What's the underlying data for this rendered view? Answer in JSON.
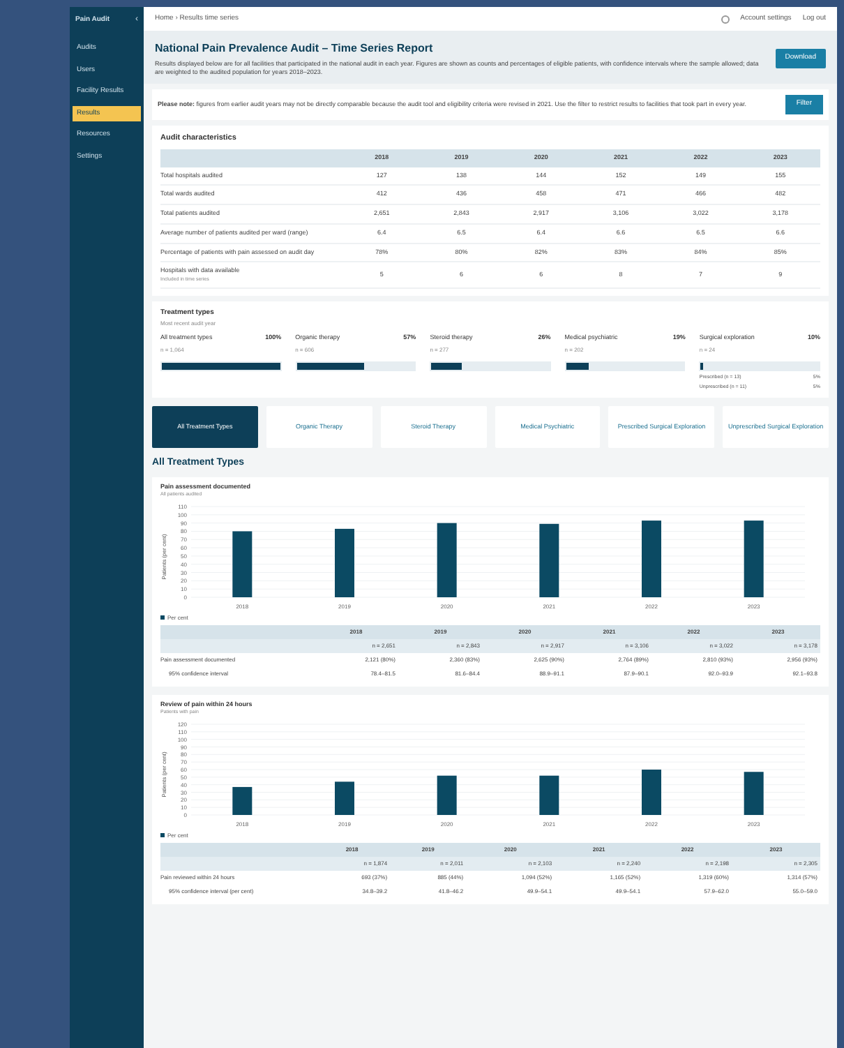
{
  "sidebar": {
    "logo": "Pain Audit",
    "collapse": "‹",
    "items": [
      {
        "label": "Audits",
        "selected": false
      },
      {
        "label": "Users",
        "selected": false
      },
      {
        "label": "Facility Results",
        "selected": false
      },
      {
        "label": "Results",
        "selected": true
      },
      {
        "label": "Resources",
        "selected": false
      },
      {
        "label": "Settings",
        "selected": false
      }
    ]
  },
  "topbar": {
    "breadcrumb": "Home › Results time series",
    "account": "Account settings",
    "logout": "Log out"
  },
  "header": {
    "title": "National Pain Prevalence Audit – Time Series Report",
    "description": "Results displayed below are for all facilities that participated in the national audit in each year. Figures are shown as counts and percentages of eligible patients, with confidence intervals where the sample allowed; data are weighted to the audited population for years 2018–2023.",
    "button": "Download"
  },
  "notice": {
    "text": "**Please note:** figures from earlier audit years may not be directly comparable because the audit tool and eligibility criteria were revised in 2021. Use the filter to restrict results to facilities that took part in every year.",
    "button": "Filter"
  },
  "audit": {
    "title": "Audit characteristics",
    "columns": [
      "2018",
      "2019",
      "2020",
      "2021",
      "2022",
      "2023"
    ],
    "rows": [
      {
        "label": "Total hospitals audited",
        "values": [
          "127",
          "138",
          "144",
          "152",
          "149",
          "155"
        ]
      },
      {
        "label": "Total wards audited",
        "values": [
          "412",
          "436",
          "458",
          "471",
          "466",
          "482"
        ]
      },
      {
        "label": "Total patients audited",
        "values": [
          "2,651",
          "2,843",
          "2,917",
          "3,106",
          "3,022",
          "3,178"
        ]
      },
      {
        "label": "Average number of patients audited per ward (range)",
        "values": [
          "6.4",
          "6.5",
          "6.4",
          "6.6",
          "6.5",
          "6.6"
        ]
      },
      {
        "label": "Percentage of patients with pain assessed on audit day",
        "values": [
          "78%",
          "80%",
          "82%",
          "83%",
          "84%",
          "85%"
        ]
      },
      {
        "label": "Hospitals with data available",
        "sub": "Included in time series",
        "values": [
          "5",
          "6",
          "6",
          "8",
          "7",
          "9"
        ]
      }
    ]
  },
  "mix": {
    "title": "Treatment types",
    "subtitle": "Most recent audit year",
    "items": [
      {
        "label": "All treatment types",
        "pct": "100%",
        "n": "n = 1,064",
        "level": 1.0
      },
      {
        "label": "Organic therapy",
        "pct": "57%",
        "n": "n = 606",
        "level": 0.57
      },
      {
        "label": "Steroid therapy",
        "pct": "26%",
        "n": "n = 277",
        "level": 0.26
      },
      {
        "label": "Medical psychiatric",
        "pct": "19%",
        "n": "n = 202",
        "level": 0.19
      },
      {
        "label": "Surgical exploration",
        "pct": "10%",
        "n": "n = 24",
        "level": 0.02,
        "breakdown": [
          {
            "label": "Prescribed (n = 13)",
            "pct": "5%"
          },
          {
            "label": "Unprescribed (n = 11)",
            "pct": "5%"
          }
        ]
      }
    ]
  },
  "tabs": [
    {
      "label": "All Treatment Types",
      "selected": true
    },
    {
      "label": "Organic Therapy",
      "selected": false
    },
    {
      "label": "Steroid Therapy",
      "selected": false
    },
    {
      "label": "Medical Psychiatric",
      "selected": false
    },
    {
      "label": "Prescribed Surgical Exploration",
      "selected": false
    },
    {
      "label": "Unprescribed Surgical Exploration",
      "selected": false
    }
  ],
  "section_title": "All Treatment Types",
  "charts": [
    {
      "title": "Pain assessment documented",
      "subtitle": "All patients audited",
      "chart_data": {
        "type": "bar",
        "grid": true,
        "ylabel": "Patients (per cent)",
        "categories": [
          "2018",
          "2019",
          "2020",
          "2021",
          "2022",
          "2023"
        ],
        "series": [
          {
            "name": "Per cent",
            "color": "#0b4a63",
            "values": [
              80,
              83,
              90,
              89,
              93,
              93
            ]
          }
        ],
        "ylim": [
          0,
          110
        ],
        "yticks": [
          0,
          10,
          20,
          30,
          40,
          50,
          60,
          70,
          80,
          90,
          100,
          110
        ]
      },
      "table": {
        "columns": [
          "2018",
          "2019",
          "2020",
          "2021",
          "2022",
          "2023"
        ],
        "n_row": [
          "n = 2,651",
          "n = 2,843",
          "n = 2,917",
          "n = 3,106",
          "n = 3,022",
          "n = 3,178"
        ],
        "rows": [
          {
            "label": "Pain assessment documented",
            "values": [
              "2,121 (80%)",
              "2,360 (83%)",
              "2,625 (90%)",
              "2,764 (89%)",
              "2,810 (93%)",
              "2,956 (93%)"
            ]
          },
          {
            "label": "95% confidence interval",
            "values": [
              "78.4–81.5",
              "81.6–84.4",
              "88.9–91.1",
              "87.9–90.1",
              "92.0–93.9",
              "92.1–93.8"
            ]
          }
        ]
      }
    },
    {
      "title": "Review of pain within 24 hours",
      "subtitle": "Patients with pain",
      "chart_data": {
        "type": "bar",
        "grid": true,
        "ylabel": "Patients (per cent)",
        "categories": [
          "2018",
          "2019",
          "2020",
          "2021",
          "2022",
          "2023"
        ],
        "series": [
          {
            "name": "Per cent",
            "color": "#0b4a63",
            "values": [
              37,
              44,
              52,
              52,
              60,
              57
            ]
          }
        ],
        "ylim": [
          0,
          120
        ],
        "yticks": [
          0,
          10,
          20,
          30,
          40,
          50,
          60,
          70,
          80,
          90,
          100,
          110,
          120
        ]
      },
      "table": {
        "columns": [
          "2018",
          "2019",
          "2020",
          "2021",
          "2022",
          "2023"
        ],
        "n_row": [
          "n = 1,874",
          "n = 2,011",
          "n = 2,103",
          "n = 2,240",
          "n = 2,198",
          "n = 2,305"
        ],
        "rows": [
          {
            "label": "Pain reviewed within 24 hours",
            "values": [
              "693 (37%)",
              "885 (44%)",
              "1,094 (52%)",
              "1,165 (52%)",
              "1,319 (60%)",
              "1,314 (57%)"
            ]
          },
          {
            "label": "95% confidence interval (per cent)",
            "values": [
              "34.8–39.2",
              "41.8–46.2",
              "49.9–54.1",
              "49.9–54.1",
              "57.9–62.0",
              "55.0–59.0"
            ]
          }
        ]
      }
    }
  ]
}
